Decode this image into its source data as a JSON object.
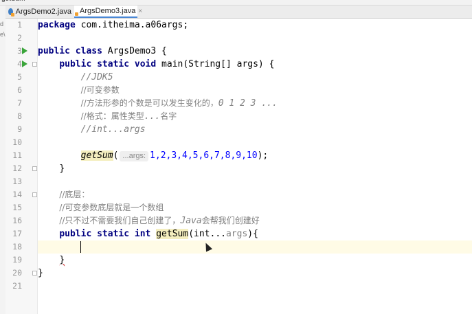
{
  "top_strip": {
    "text": "getSum"
  },
  "tabs": [
    {
      "label": "ArgsDemo2.java"
    },
    {
      "label": "ArgsDemo3.java",
      "active": true
    }
  ],
  "editor": {
    "line_numbers": [
      "1",
      "2",
      "3",
      "4",
      "5",
      "6",
      "7",
      "8",
      "9",
      "10",
      "11",
      "12",
      "13",
      "14",
      "15",
      "16",
      "17",
      "18",
      "19",
      "20",
      "21"
    ],
    "tokens": {
      "package_kw": "package",
      "package_name": " com.itheima.a06args;",
      "public": "public",
      "class": "class",
      "static": "static",
      "void": "void",
      "int": "int",
      "class_name": " ArgsDemo3 {",
      "main_sig": " main(String[] args) {",
      "c_jdk5": "//JDK5",
      "c_varargs": "//可变参数",
      "c_varargs_pre": "//方法形参的个数是可以发生变化的，",
      "c_varargs_nums": "0 1 2 3 ...",
      "c_format_pre": "//格式：属性类型",
      "c_format_mid": "...",
      "c_format_post": "名字",
      "c_int_args": "//int...args",
      "call_name": "getSum",
      "call_open": "(",
      "call_hint": "...args:",
      "call_args": "1,2,3,4,5,6,7,8,9,10",
      "call_close": ");",
      "brace_close": "}",
      "c_bottom": "//底层：",
      "c_array": "//可变参数底层就是一个数组",
      "c_java_pre": "//只不过不需要我们自己创建了，",
      "c_java_word": "Java",
      "c_java_post": "会帮我们创建好",
      "method_name": "getSum",
      "method_params_open": "(int...",
      "method_params_args": "args",
      "method_params_close": "){"
    }
  }
}
